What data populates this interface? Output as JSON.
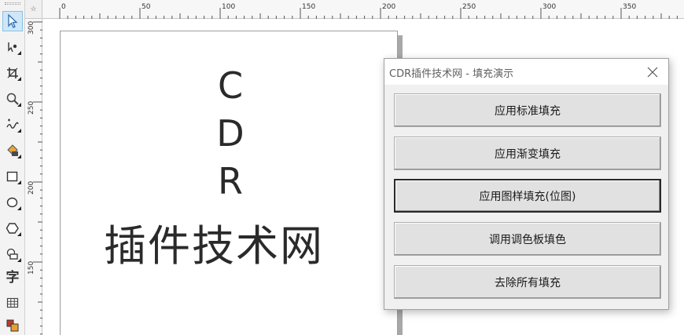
{
  "ruler": {
    "corner_label": "☆",
    "top_labels": [
      "0",
      "50",
      "100",
      "150",
      "200",
      "250",
      "300",
      "350"
    ],
    "left_labels": [
      "300",
      "250",
      "200",
      "150"
    ]
  },
  "toolbox": {
    "tools": [
      {
        "icon": "pick-arrow-icon",
        "active": true
      },
      {
        "icon": "shape-edit-icon"
      },
      {
        "icon": "crop-icon"
      },
      {
        "icon": "zoom-icon"
      },
      {
        "icon": "freehand-icon"
      },
      {
        "icon": "smart-fill-icon"
      },
      {
        "icon": "rectangle-icon"
      },
      {
        "icon": "ellipse-icon"
      },
      {
        "icon": "polygon-icon"
      },
      {
        "icon": "basic-shapes-icon"
      },
      {
        "icon": "text-tool-icon",
        "glyph": "字"
      },
      {
        "icon": "table-icon"
      },
      {
        "icon": "interactive-fill-icon"
      }
    ]
  },
  "document": {
    "letters": [
      "C",
      "D",
      "R"
    ],
    "site_name": "插件技术网"
  },
  "dialog": {
    "title": "CDR插件技术网 - 填充演示",
    "close_label": "✕",
    "buttons": [
      {
        "label": "应用标准填充"
      },
      {
        "label": "应用渐变填充"
      },
      {
        "label": "应用图样填充(位图)",
        "focused": true
      },
      {
        "label": "调用调色板填色"
      },
      {
        "label": "去除所有填充"
      }
    ]
  }
}
